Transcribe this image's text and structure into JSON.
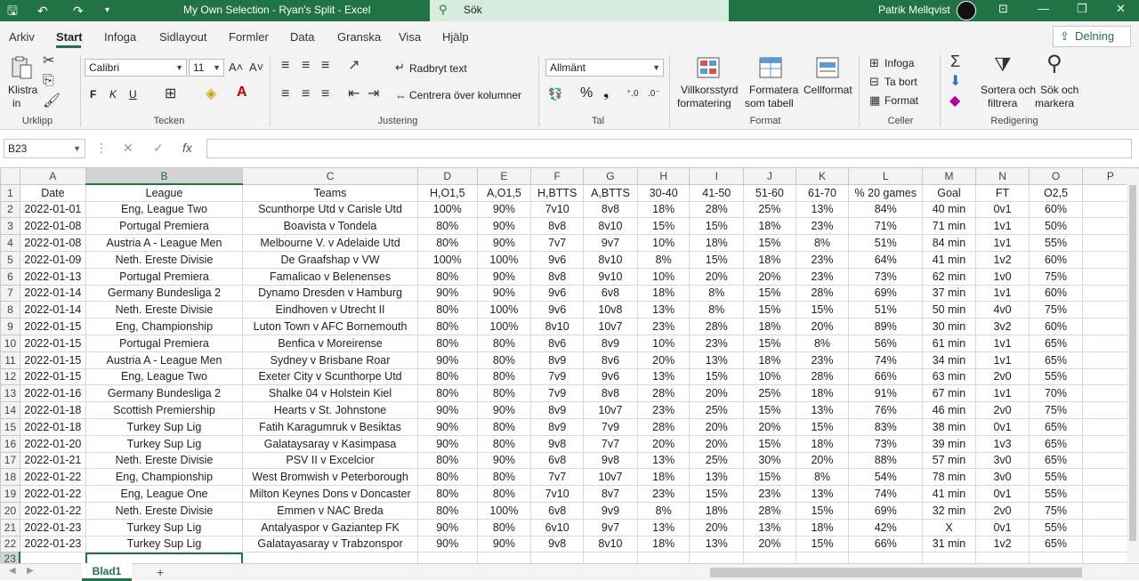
{
  "titlebar": {
    "title": "My Own Selection - Ryan's Split  -  Excel",
    "search_placeholder": "Sök",
    "user": "Patrik Mellqvist"
  },
  "menu": {
    "tabs": [
      "Arkiv",
      "Start",
      "Infoga",
      "Sidlayout",
      "Formler",
      "Data",
      "Granska",
      "Visa",
      "Hjälp"
    ],
    "share": "Delning"
  },
  "ribbon": {
    "clipboard": {
      "paste": "Klistra",
      "paste2": "in",
      "label": "Urklipp"
    },
    "font": {
      "name": "Calibri",
      "size": "11",
      "bold": "F",
      "italic": "K",
      "underline": "U",
      "label": "Tecken"
    },
    "alignment": {
      "wrap": "Radbryt text",
      "merge": "Centrera över kolumner",
      "label": "Justering"
    },
    "number": {
      "format": "Allmänt",
      "percent": "%",
      "comma": "❟",
      "label": "Tal"
    },
    "styles": {
      "cond1": "Villkorsstyrd",
      "cond2": "formatering",
      "table1": "Formatera",
      "table2": "som tabell",
      "cell": "Cellformat",
      "label": "Format"
    },
    "cells": {
      "insert": "Infoga",
      "delete": "Ta bort",
      "format": "Format",
      "label": "Celler"
    },
    "editing": {
      "sort1": "Sortera och",
      "sort2": "filtrera",
      "find1": "Sök och",
      "find2": "markera",
      "label": "Redigering"
    }
  },
  "formula_bar": {
    "name_box": "B23",
    "fx": "fx",
    "content": ""
  },
  "sheet": {
    "columns": [
      "A",
      "B",
      "C",
      "D",
      "E",
      "F",
      "G",
      "H",
      "I",
      "J",
      "K",
      "L",
      "M",
      "N",
      "O",
      "P"
    ],
    "headers": [
      "Date",
      "League",
      "Teams",
      "H,O1,5",
      "A,O1,5",
      "H,BTTS",
      "A,BTTS",
      "30-40",
      "41-50",
      "51-60",
      "61-70",
      "% 20 games",
      "Goal",
      "FT",
      "O2,5"
    ],
    "rows": [
      [
        "2022-01-01",
        "Eng, League Two",
        "Scunthorpe Utd v Carisle Utd",
        "100%",
        "90%",
        "7v10",
        "8v8",
        "18%",
        "28%",
        "25%",
        "13%",
        "84%",
        "40  min",
        "0v1",
        "60%"
      ],
      [
        "2022-01-08",
        "Portugal Premiera",
        "Boavista v Tondela",
        "80%",
        "90%",
        "8v8",
        "8v10",
        "15%",
        "15%",
        "18%",
        "23%",
        "71%",
        "71 min",
        "1v1",
        "50%"
      ],
      [
        "2022-01-08",
        "Austria A - League Men",
        "Melbourne V. v Adelaide Utd",
        "80%",
        "90%",
        "7v7",
        "9v7",
        "10%",
        "18%",
        "15%",
        "8%",
        "51%",
        "84 min",
        "1v1",
        "55%"
      ],
      [
        "2022-01-09",
        "Neth. Ereste Divisie",
        "De Graafshap v VW",
        "100%",
        "100%",
        "9v6",
        "8v10",
        "8%",
        "15%",
        "18%",
        "23%",
        "64%",
        "41 min",
        "1v2",
        "60%"
      ],
      [
        "2022-01-13",
        "Portugal Premiera",
        "Famalicao v Belenenses",
        "80%",
        "90%",
        "8v8",
        "9v10",
        "10%",
        "20%",
        "20%",
        "23%",
        "73%",
        "62 min",
        "1v0",
        "75%"
      ],
      [
        "2022-01-14",
        "Germany Bundesliga 2",
        "Dynamo Dresden v Hamburg",
        "90%",
        "90%",
        "9v6",
        "6v8",
        "18%",
        "8%",
        "15%",
        "28%",
        "69%",
        "37 min",
        "1v1",
        "60%"
      ],
      [
        "2022-01-14",
        "Neth. Ereste Divisie",
        "Eindhoven v Utrecht II",
        "80%",
        "100%",
        "9v6",
        "10v8",
        "13%",
        "8%",
        "15%",
        "15%",
        "51%",
        "50 min",
        "4v0",
        "75%"
      ],
      [
        "2022-01-15",
        "Eng, Championship",
        "Luton Town v AFC Bornemouth",
        "80%",
        "100%",
        "8v10",
        "10v7",
        "23%",
        "28%",
        "18%",
        "20%",
        "89%",
        "30 min",
        "3v2",
        "60%"
      ],
      [
        "2022-01-15",
        "Portugal Premiera",
        "Benfica v Moreirense",
        "80%",
        "80%",
        "8v6",
        "8v9",
        "10%",
        "23%",
        "15%",
        "8%",
        "56%",
        "61 min",
        "1v1",
        "65%"
      ],
      [
        "2022-01-15",
        "Austria A - League Men",
        "Sydney v Brisbane Roar",
        "90%",
        "80%",
        "8v9",
        "8v6",
        "20%",
        "13%",
        "18%",
        "23%",
        "74%",
        "34 min",
        "1v1",
        "65%"
      ],
      [
        "2022-01-15",
        "Eng, League Two",
        "Exeter City v Scunthorpe Utd",
        "80%",
        "80%",
        "7v9",
        "9v6",
        "13%",
        "15%",
        "10%",
        "28%",
        "66%",
        "63 min",
        "2v0",
        "55%"
      ],
      [
        "2022-01-16",
        "Germany Bundesliga 2",
        "Shalke 04 v Holstein Kiel",
        "80%",
        "80%",
        "7v9",
        "8v8",
        "28%",
        "20%",
        "25%",
        "18%",
        "91%",
        "67 min",
        "1v1",
        "70%"
      ],
      [
        "2022-01-18",
        "Scottish Premiership",
        "Hearts v St. Johnstone",
        "90%",
        "90%",
        "8v9",
        "10v7",
        "23%",
        "25%",
        "15%",
        "13%",
        "76%",
        "46 min",
        "2v0",
        "75%"
      ],
      [
        "2022-01-18",
        "Turkey Sup Lig",
        "Fatih Karagumruk v Besiktas",
        "90%",
        "80%",
        "8v9",
        "7v9",
        "28%",
        "20%",
        "20%",
        "15%",
        "83%",
        "38 min",
        "0v1",
        "65%"
      ],
      [
        "2022-01-20",
        "Turkey Sup Lig",
        "Galataysaray v Kasimpasa",
        "90%",
        "80%",
        "9v8",
        "7v7",
        "20%",
        "20%",
        "15%",
        "18%",
        "73%",
        "39 min",
        "1v3",
        "65%"
      ],
      [
        "2022-01-21",
        "Neth. Ereste Divisie",
        "PSV II v Excelcior",
        "80%",
        "90%",
        "6v8",
        "9v8",
        "13%",
        "25%",
        "30%",
        "20%",
        "88%",
        "57 min",
        "3v0",
        "65%"
      ],
      [
        "2022-01-22",
        "Eng, Championship",
        "West Bromwish v Peterborough",
        "80%",
        "80%",
        "7v7",
        "10v7",
        "18%",
        "13%",
        "15%",
        "8%",
        "54%",
        "78 min",
        "3v0",
        "55%"
      ],
      [
        "2022-01-22",
        "Eng, League One",
        "Milton Keynes Dons v Doncaster",
        "80%",
        "80%",
        "7v10",
        "8v7",
        "23%",
        "15%",
        "23%",
        "13%",
        "74%",
        "41 min",
        "0v1",
        "55%"
      ],
      [
        "2022-01-22",
        "Neth. Ereste Divisie",
        "Emmen v NAC Breda",
        "80%",
        "100%",
        "6v8",
        "9v9",
        "8%",
        "18%",
        "28%",
        "15%",
        "69%",
        "32 min",
        "2v0",
        "75%"
      ],
      [
        "2022-01-23",
        "Turkey Sup Lig",
        "Antalyaspor v Gaziantep FK",
        "90%",
        "80%",
        "6v10",
        "9v7",
        "13%",
        "20%",
        "13%",
        "18%",
        "42%",
        "X",
        "0v1",
        "55%"
      ],
      [
        "2022-01-23",
        "Turkey Sup Lig",
        "Galatayasaray v Trabzonspor",
        "90%",
        "90%",
        "9v8",
        "8v10",
        "18%",
        "13%",
        "20%",
        "15%",
        "66%",
        "31 min",
        "1v2",
        "65%"
      ]
    ],
    "last_row_number": "23"
  },
  "sheet_tabs": {
    "active": "Blad1",
    "add": "+"
  }
}
